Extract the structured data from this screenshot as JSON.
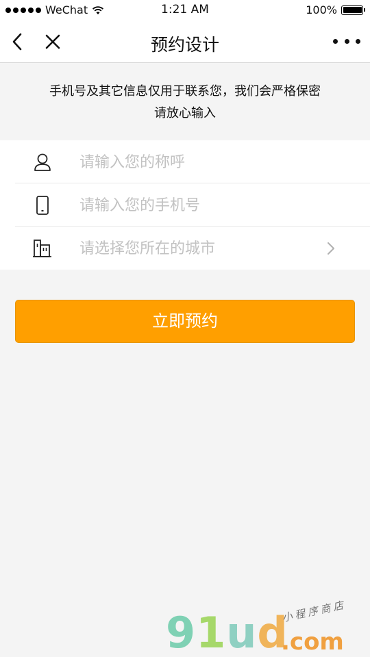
{
  "status_bar": {
    "carrier": "WeChat",
    "time": "1:21 AM",
    "battery": "100%"
  },
  "nav": {
    "title": "预约设计"
  },
  "notice": {
    "line1": "手机号及其它信息仅用于联系您，我们会严格保密",
    "line2": "请放心输入"
  },
  "form": {
    "name_placeholder": "请输入您的称呼",
    "phone_placeholder": "请输入您的手机号",
    "city_placeholder": "请选择您所在的城市"
  },
  "submit_label": "立即预约",
  "watermark": {
    "part1": "9",
    "part2": "1",
    "part3": "u",
    "part4": "d",
    "suffix": ".com",
    "tagline": "小程序商店"
  },
  "colors": {
    "accent": "#ff9f00",
    "background": "#f4f4f4",
    "placeholder": "#c2c2c2"
  },
  "icons": [
    "back-icon",
    "close-icon",
    "more-icon",
    "user-icon",
    "phone-icon",
    "building-icon",
    "chevron-right-icon",
    "wifi-icon",
    "battery-icon"
  ]
}
